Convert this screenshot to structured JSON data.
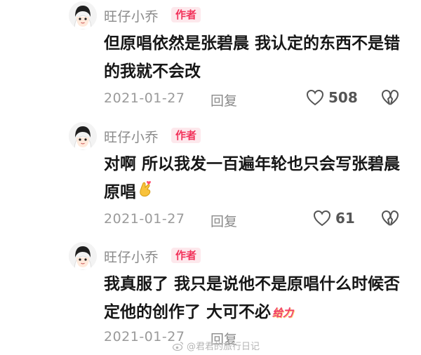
{
  "comments": [
    {
      "author": "旺仔小乔",
      "badge": "作者",
      "text": "但原唱依然是张碧晨 我认定的东西不是错的我就不会改",
      "date": "2021-01-27",
      "reply": "回复",
      "likes": "508"
    },
    {
      "author": "旺仔小乔",
      "badge": "作者",
      "text": "对啊 所以我发一百遍年轮也只会写张碧晨原唱",
      "date": "2021-01-27",
      "reply": "回复",
      "likes": "61"
    },
    {
      "author": "旺仔小乔",
      "badge": "作者",
      "text": "我真服了 我只是说他不是原唱什么时候否定他的创作了 大可不必",
      "sticker": "给力",
      "date": "2021-01-27",
      "reply": "回复"
    }
  ],
  "watermark": "@君君的旅行日记"
}
